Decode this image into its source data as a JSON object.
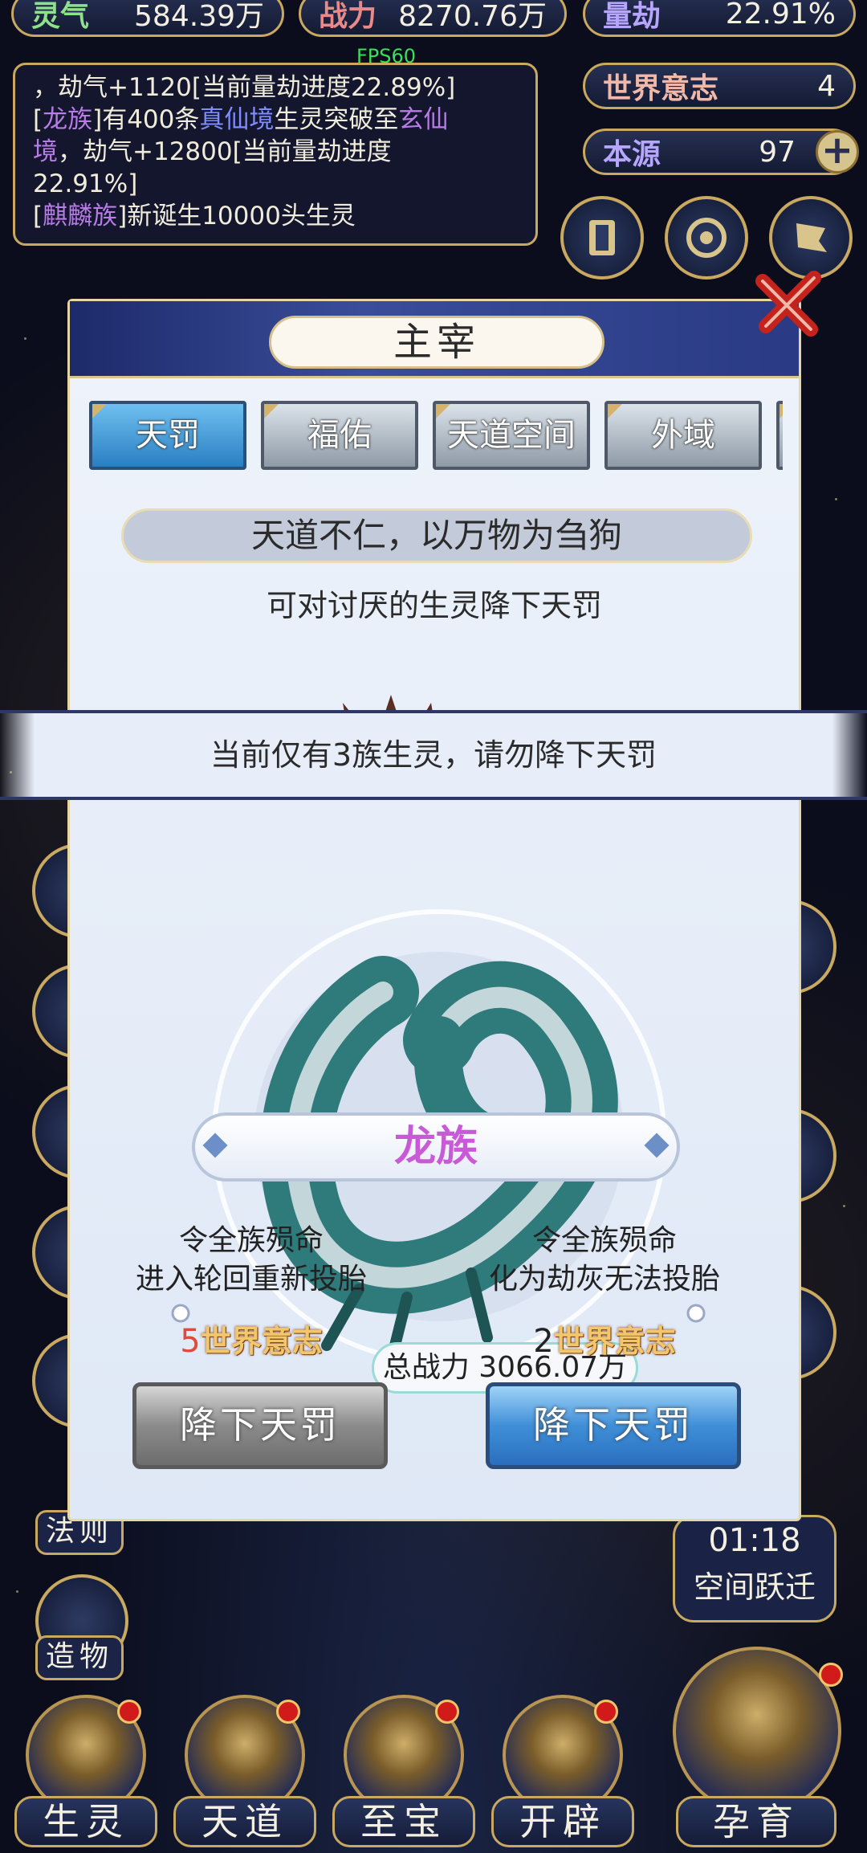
{
  "top_bar": {
    "lingqi_label": "灵气",
    "lingqi_value": "584.39万",
    "power_label": "战力",
    "power_value": "8270.76万",
    "liangjie_label": "量劫",
    "liangjie_value": "22.91%",
    "fps": "FPS60"
  },
  "log": {
    "line1": "，劫气+1120[当前量劫进度22.89%]",
    "line2_a": "[",
    "line2_race": "龙族",
    "line2_b": "]有400条",
    "line2_realm1": "真仙境",
    "line2_c": "生灵突破至",
    "line2_realm2": "玄仙",
    "line3_realm2": "境",
    "line3_b": "，劫气+12800[当前量劫进度",
    "line4": "22.91%]",
    "line5_a": "[",
    "line5_race": "麒麟族",
    "line5_b": "]新诞生10000头生灵"
  },
  "right_panel": {
    "world_will_label": "世界意志",
    "world_will_value": "4",
    "origin_label": "本源",
    "origin_value": "97"
  },
  "modal": {
    "title": "主宰",
    "tabs": [
      "天罚",
      "福佑",
      "天道空间",
      "外域"
    ],
    "active_tab": 0,
    "motto": "天道不仁，以万物为刍狗",
    "description": "可对讨厌的生灵降下天罚",
    "warning": "当前仅有3族生灵，请勿降下天罚",
    "total_power": "总战力 3066.07万",
    "race_name": "龙族",
    "option_left": {
      "line1": "令全族殒命",
      "line2": "进入轮回重新投胎",
      "cost_num": "5",
      "cost_unit": "世界意志",
      "button": "降下天罚"
    },
    "option_right": {
      "line1": "令全族殒命",
      "line2": "化为劫灰无法投胎",
      "cost_num": "2",
      "cost_unit": "世界意志",
      "button": "降下天罚"
    }
  },
  "side": {
    "fa_ze": "法则",
    "zao_wu": "造物",
    "timer": "01:18",
    "timer_label": "空间跃迁"
  },
  "bottom_nav": [
    "生灵",
    "天道",
    "至宝",
    "开辟",
    "孕育"
  ],
  "colors": {
    "gold": "#c9a860",
    "active_tab": "#3a8fd0",
    "race_name": "#c85ad8",
    "cost_warning": "#e04a3a"
  }
}
